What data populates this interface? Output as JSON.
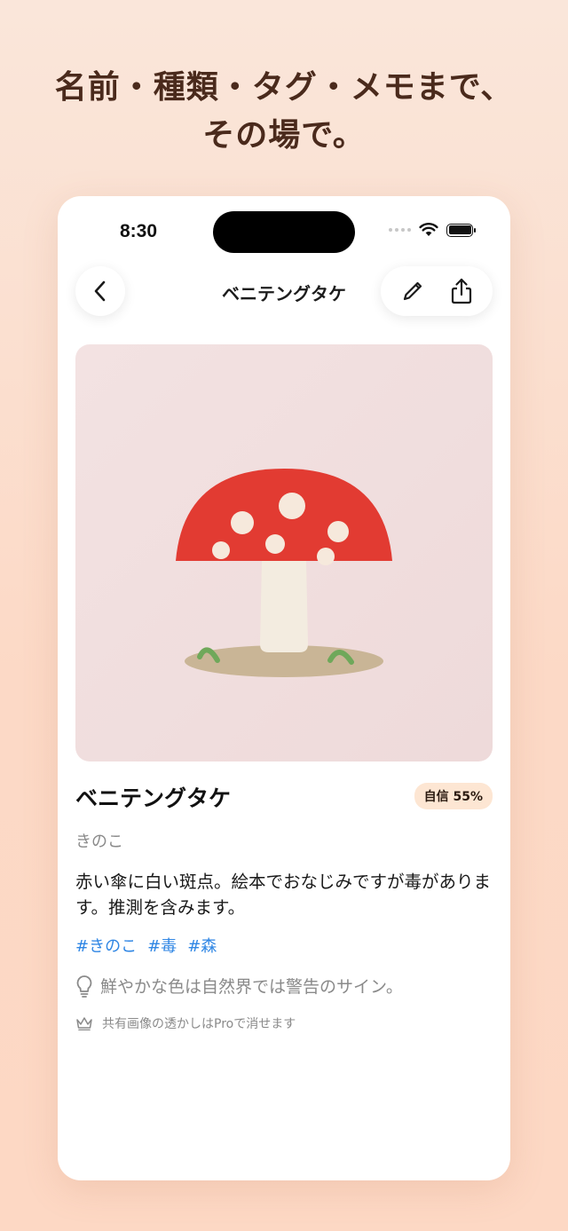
{
  "headline": {
    "line1": "名前・種類・タグ・メモまで、",
    "line2": "その場で。"
  },
  "status_bar": {
    "time": "8:30"
  },
  "nav": {
    "title": "ベニテングタケ",
    "back_icon": "chevron-left-icon",
    "edit_icon": "pencil-icon",
    "share_icon": "share-icon"
  },
  "detail": {
    "name": "ベニテングタケ",
    "confidence_badge": "自信 55%",
    "category": "きのこ",
    "description": "赤い傘に白い斑点。絵本でおなじみですが毒があります。推測を含みます。",
    "tags": [
      "#きのこ",
      "#毒",
      "#森"
    ],
    "tip": "鮮やかな色は自然界では警告のサイン。",
    "pro_note": "共有画像の透かしはProで消せます"
  },
  "colors": {
    "accent_tag": "#2f86e4",
    "cap_red": "#e23b32",
    "badge_bg": "#fde6d3",
    "headline": "#4a2a1c"
  }
}
